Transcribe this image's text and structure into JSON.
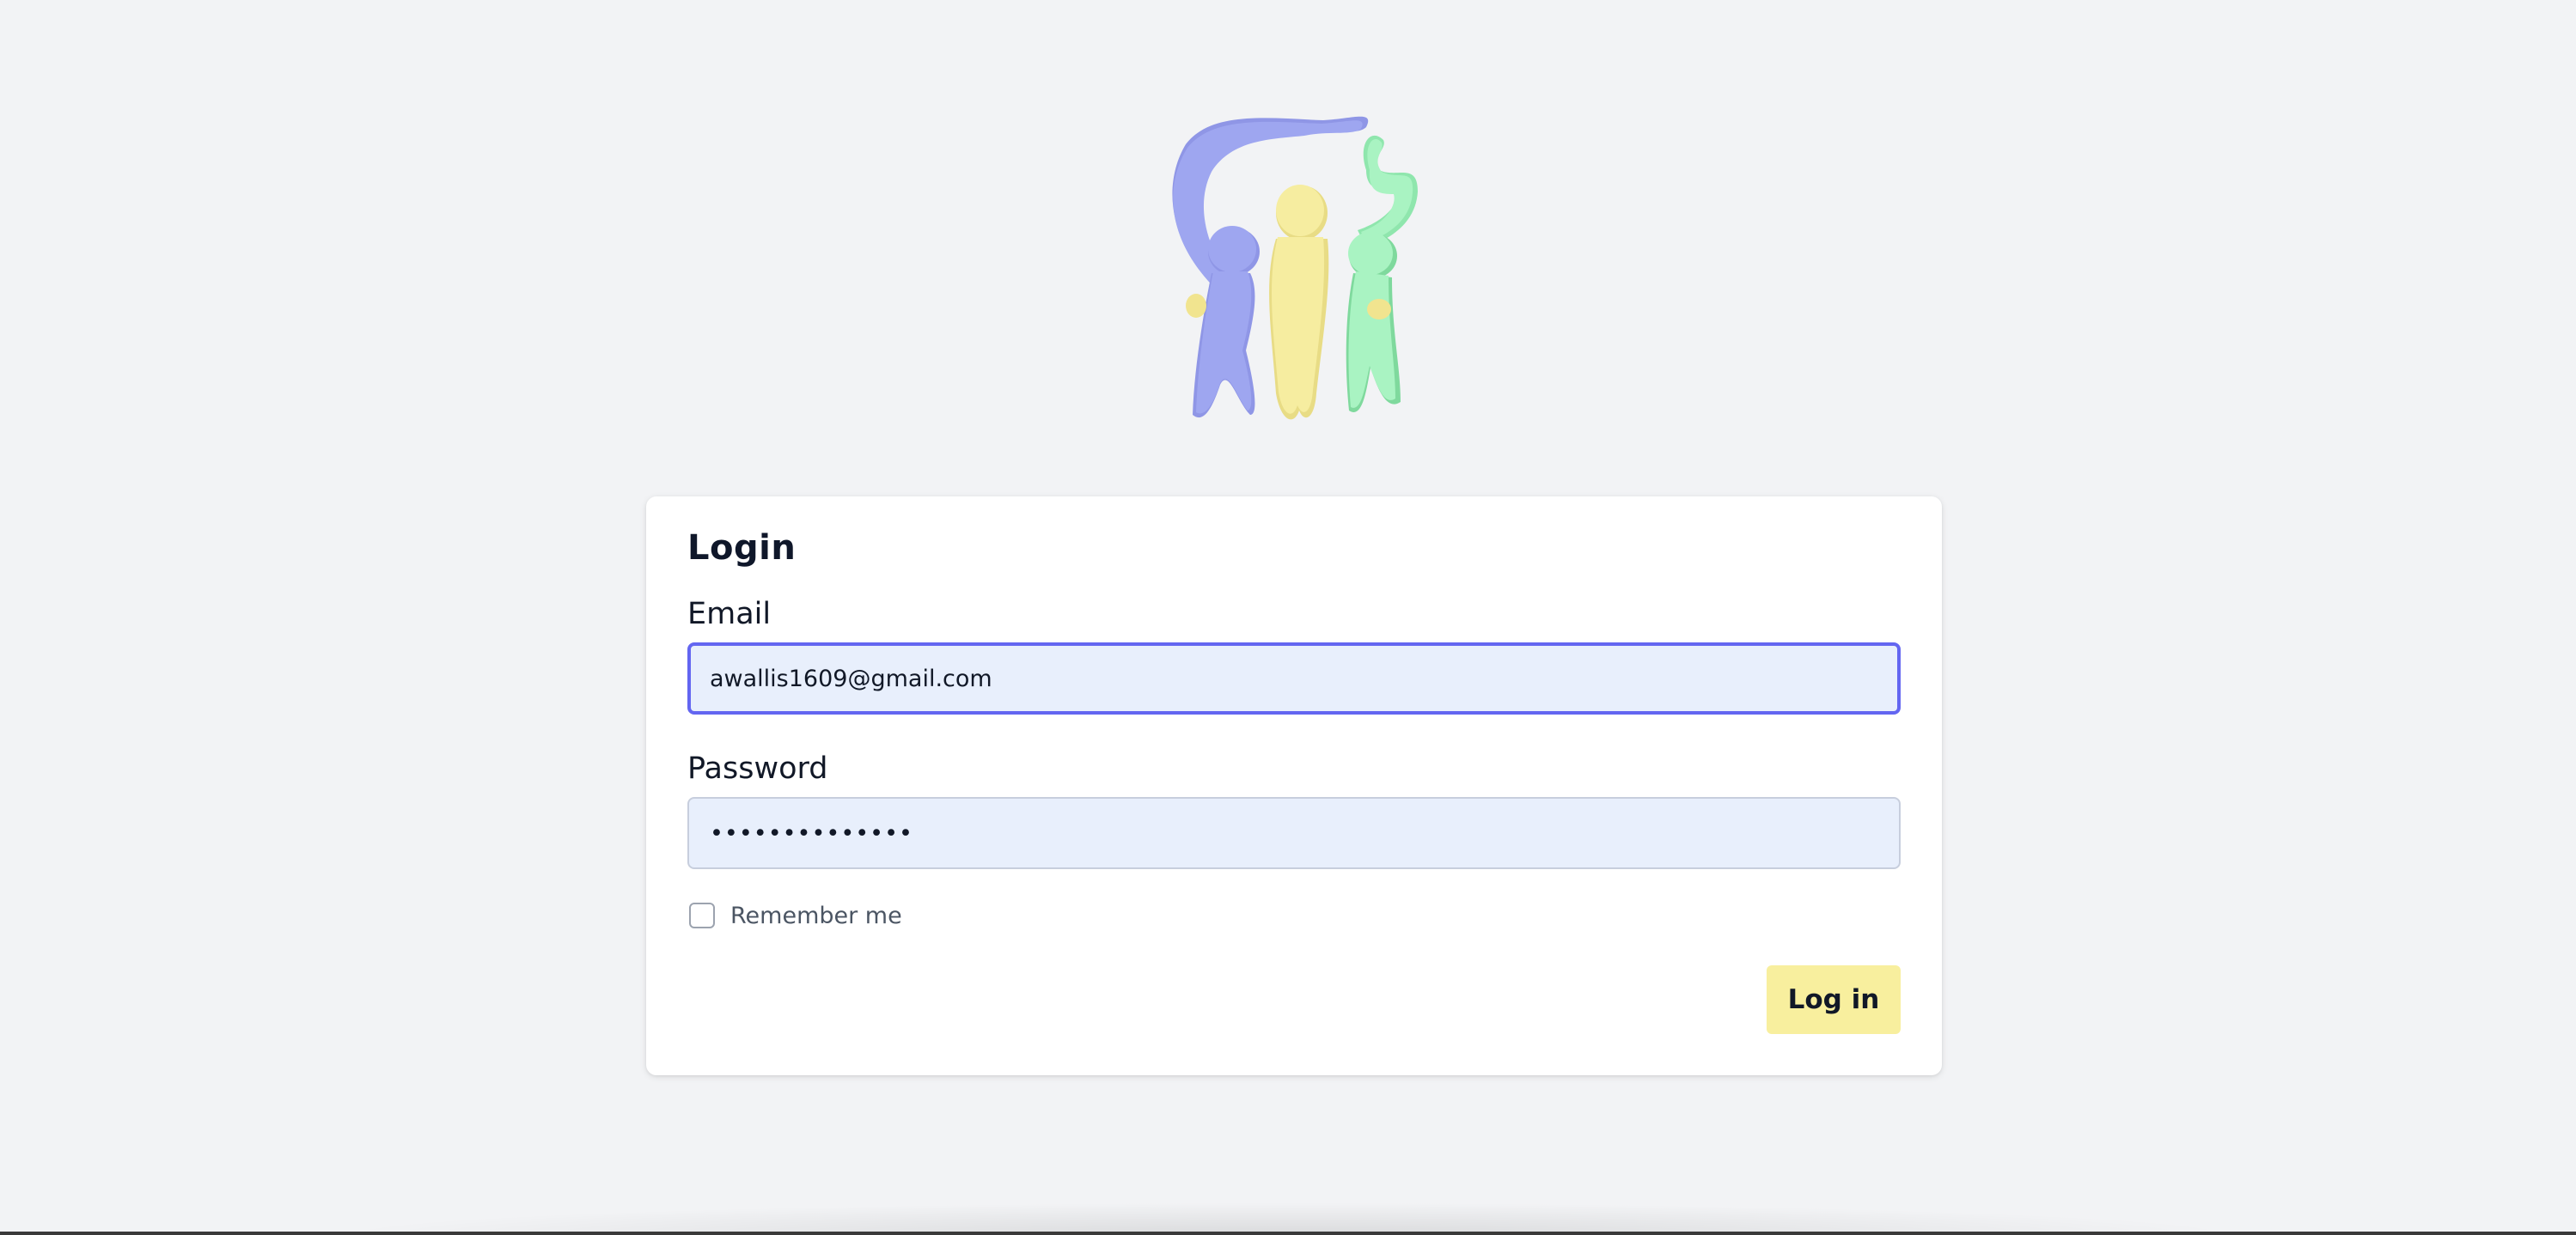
{
  "app": {
    "logo_icon": "family-figures-logo"
  },
  "login": {
    "title": "Login",
    "email_label": "Email",
    "email_value": "awallis1609@gmail.com",
    "password_label": "Password",
    "password_value": "••••••••••••••",
    "remember_label": "Remember me",
    "remember_checked": false,
    "submit_label": "Log in"
  },
  "colors": {
    "background": "#f2f3f5",
    "focus_ring": "#6366f1",
    "input_fill": "#e8effc",
    "button_fill": "#f8ef9e",
    "figure_blue": "#9ea6f0",
    "figure_yellow": "#f6eda0",
    "figure_green": "#a9f3c2"
  }
}
